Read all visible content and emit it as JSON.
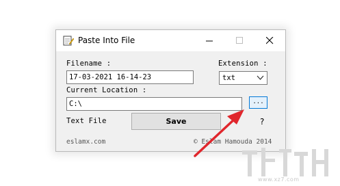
{
  "window": {
    "title": "Paste Into File",
    "icon": "notepad-pencil-icon"
  },
  "form": {
    "filename_label": "Filename :",
    "filename_value": "17-03-2021 16-14-23",
    "extension_label": "Extension :",
    "extension_value": "txt",
    "location_label": "Current Location :",
    "location_value": "C:\\",
    "browse_label": "...",
    "text_file_label": "Text File",
    "save_label": "Save",
    "help_label": "?"
  },
  "footer": {
    "website": "eslamx.com",
    "copyright": "© Eslam Hamouda 2014"
  },
  "colors": {
    "arrow": "#e0262c",
    "accent": "#0078d7"
  },
  "watermark": {
    "subtext": "www.xz7.com"
  }
}
